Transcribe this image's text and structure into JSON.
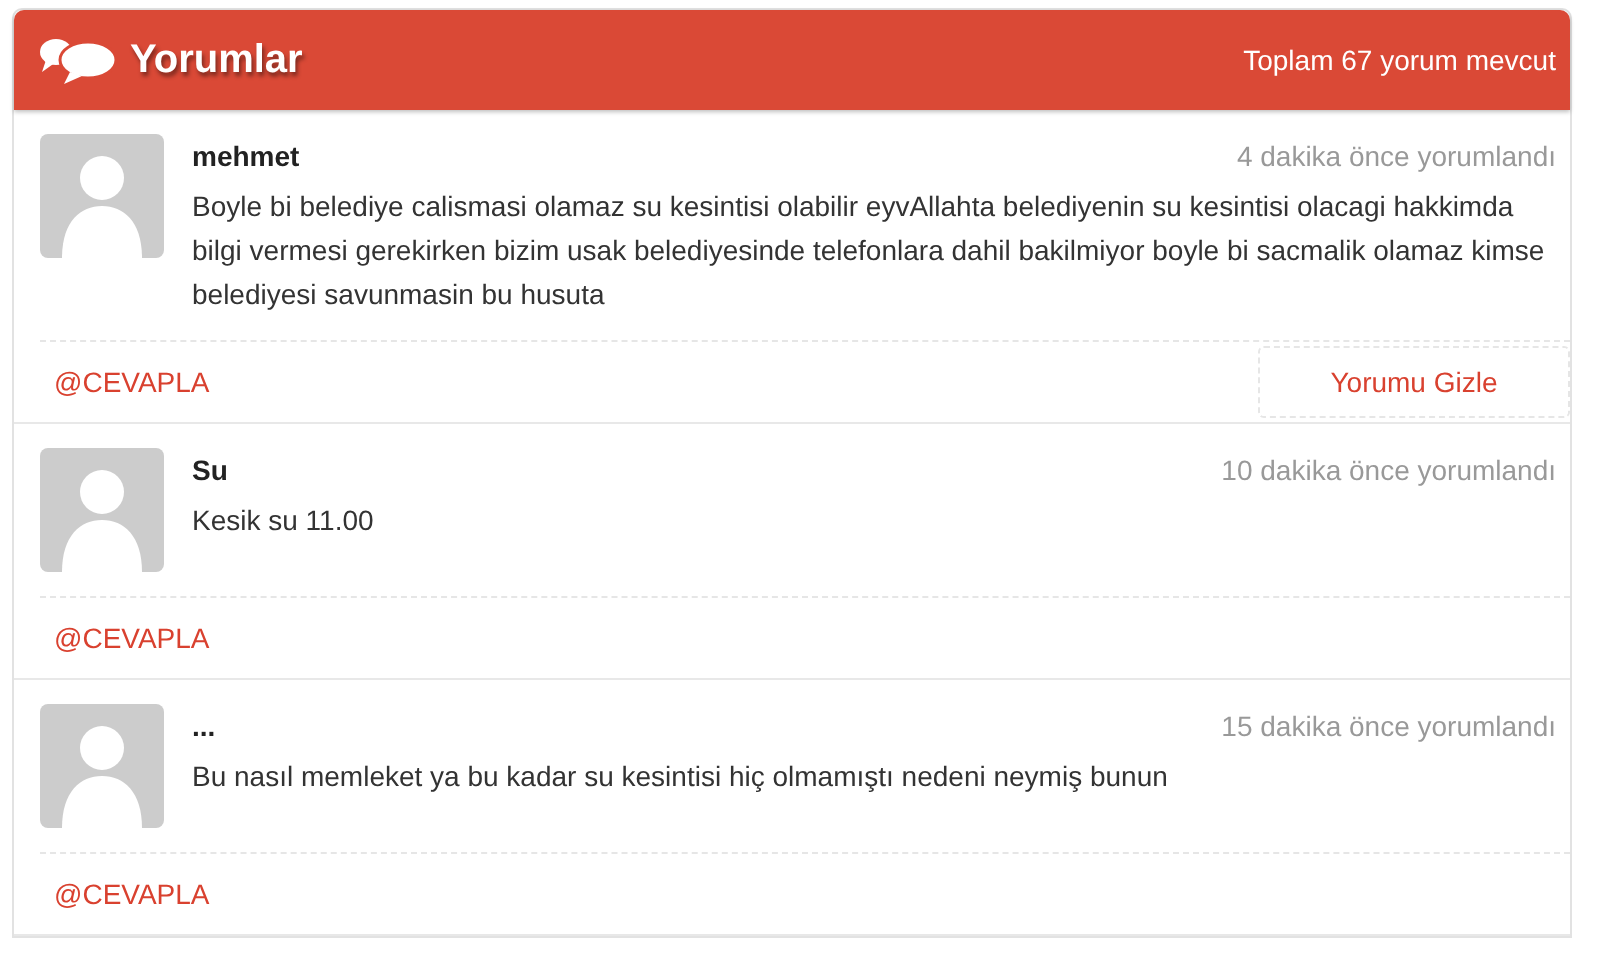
{
  "header": {
    "title": "Yorumlar",
    "total": "Toplam 67 yorum mevcut"
  },
  "comments": [
    {
      "author": "mehmet",
      "time": "4 dakika önce yorumlandı",
      "text": "Boyle bi belediye calismasi olamaz su kesintisi olabilir eyvAllahta belediyenin su kesintisi olacagi hakkimda bilgi vermesi gerekirken bizim usak belediyesinde telefonlara dahil bakilmiyor boyle bi sacmalik olamaz kimse belediyesi savunmasin bu husuta",
      "reply": "@CEVAPLA",
      "hide": "Yorumu Gizle"
    },
    {
      "author": "Su",
      "time": "10 dakika önce yorumlandı",
      "text": "Kesik su 11.00",
      "reply": "@CEVAPLA"
    },
    {
      "author": "...",
      "time": "15 dakika önce yorumlandı",
      "text": "Bu nasıl memleket ya bu kadar su kesintisi hiç olmamıştı nedeni neymiş bunun",
      "reply": "@CEVAPLA"
    }
  ]
}
